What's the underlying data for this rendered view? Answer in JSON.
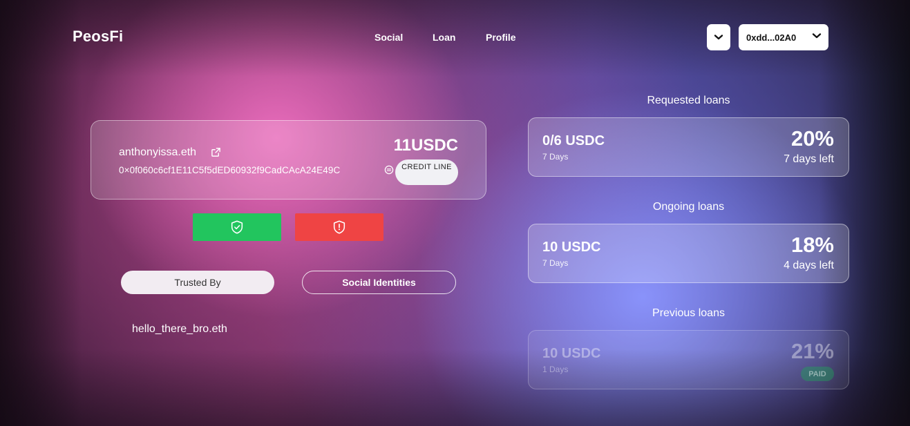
{
  "app": {
    "brand": "PeosFi"
  },
  "nav": {
    "items": [
      "Social",
      "Loan",
      "Profile"
    ]
  },
  "wallet": {
    "address_short": "0xdd...02A0"
  },
  "profile": {
    "ens": "anthonyissa.eth",
    "address": "0×0f060c6cf1E11C5f5dED60932f9CadCAcA24E49C",
    "credit_amount": "11USDC",
    "credit_label": "CREDIT LINE"
  },
  "tabs": {
    "trusted_by": "Trusted By",
    "social_identities": "Social Identities"
  },
  "trusted_by": [
    "hello_there_bro.eth"
  ],
  "loans": {
    "requested": {
      "title": "Requested loans",
      "amount": "0/6 USDC",
      "term": "7 Days",
      "rate": "20%",
      "status": "7 days left"
    },
    "ongoing": {
      "title": "Ongoing loans",
      "amount": "10 USDC",
      "term": "7 Days",
      "rate": "18%",
      "status": "4 days left"
    },
    "previous": {
      "title": "Previous loans",
      "amount": "10 USDC",
      "term": "1 Days",
      "rate": "21%",
      "status": "PAID"
    }
  },
  "colors": {
    "trust": "#22c55e",
    "flag": "#ef4444",
    "paid": "#22a05a"
  },
  "icons": {
    "chain_selector": "chevron-down-icon",
    "wallet_dropdown": "chevron-down-icon",
    "external_link": "external-link-icon",
    "copy": "copy-icon",
    "trust_button": "shield-check-icon",
    "flag_button": "shield-alert-icon"
  }
}
